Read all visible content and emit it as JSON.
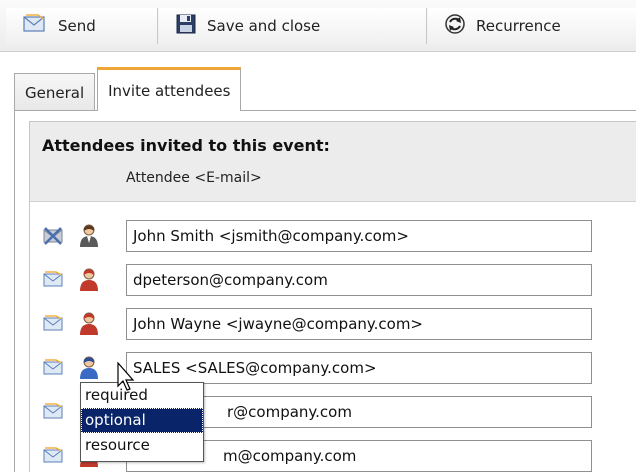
{
  "toolbar": {
    "send_label": "Send",
    "save_close_label": "Save and close",
    "recurrence_label": "Recurrence",
    "send_icon": "envelope-icon",
    "save_icon": "floppy-disk-icon",
    "recurrence_icon": "refresh-icon"
  },
  "tabs": [
    {
      "label": "General",
      "active": false
    },
    {
      "label": "Invite attendees",
      "active": true
    }
  ],
  "attendees": {
    "title": "Attendees invited to this event:",
    "column_header": "Attendee <E-mail>",
    "rows": [
      {
        "value": "John Smith <jsmith@company.com>",
        "mail_icon": "envelope-x-icon",
        "person_icon": "person-required-icon"
      },
      {
        "value": "dpeterson@company.com",
        "mail_icon": "envelope-icon",
        "person_icon": "person-required-icon"
      },
      {
        "value": "John Wayne <jwayne@company.com>",
        "mail_icon": "envelope-icon",
        "person_icon": "person-required-icon"
      },
      {
        "value": "SALES <SALES@company.com>",
        "mail_icon": "envelope-icon",
        "person_icon": "person-optional-icon"
      },
      {
        "value": "r@company.com",
        "mail_icon": "envelope-icon",
        "person_icon": "person-required-icon"
      },
      {
        "value": "m@company.com",
        "mail_icon": "envelope-icon",
        "person_icon": "person-required-icon"
      }
    ]
  },
  "role_dropdown": {
    "options": [
      "required",
      "optional",
      "resource"
    ],
    "selected": "optional"
  },
  "colors": {
    "tab_accent": "#f0a637",
    "selection_bg": "#0a246a",
    "header_bg": "#ececec"
  }
}
